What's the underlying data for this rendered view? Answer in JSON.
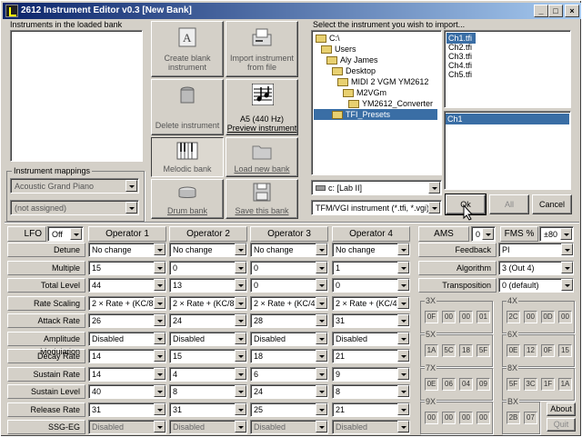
{
  "window": {
    "title": "2612 Instrument Editor v0.3 [New Bank]"
  },
  "bank": {
    "list_label": "Instruments in the loaded bank",
    "mappings_label": "Instrument mappings",
    "mapping_value": "Acoustic Grand Piano",
    "assign_value": "(not assigned)"
  },
  "buttons": {
    "create": "Create blank instrument",
    "import": "Import instrument from file",
    "delete": "Delete instrument",
    "preview_note": "A5 (440 Hz)",
    "preview": "Preview instrument",
    "melodic": "Melodic bank",
    "load": "Load new bank",
    "drum": "Drum bank",
    "save": "Save this bank",
    "ok": "Ok",
    "all": "All",
    "cancel": "Cancel",
    "about": "About",
    "quit": "Quit"
  },
  "import": {
    "label": "Select the instrument you wish to import...",
    "tree": [
      "C:\\",
      "Users",
      "Aly James",
      "Desktop",
      "MIDI 2 VGM YM2612",
      "M2VGm",
      "YM2612_Converter",
      "TFI_Presets"
    ],
    "files": [
      "Ch1.tfi",
      "Ch2.tfi",
      "Ch3.tfi",
      "Ch4.tfi",
      "Ch5.tfi"
    ],
    "channels": [
      "Ch1"
    ],
    "drive": "c: [Lab II]",
    "filter": "TFM/VGI instrument (*.tfi, *.vgi)"
  },
  "lfo": {
    "label": "LFO",
    "value": "Off"
  },
  "operators": [
    "Operator 1",
    "Operator 2",
    "Operator 3",
    "Operator 4"
  ],
  "params": [
    {
      "label": "Detune",
      "values": [
        "No change",
        "No change",
        "No change",
        "No change"
      ],
      "disabled": false
    },
    {
      "label": "Multiple",
      "values": [
        "15",
        "0",
        "0",
        "1"
      ],
      "disabled": false
    },
    {
      "label": "Total Level",
      "values": [
        "44",
        "13",
        "0",
        "0"
      ],
      "disabled": false
    },
    {
      "label": "Rate Scaling",
      "values": [
        "2 × Rate + (KC/8)",
        "2 × Rate + (KC/8)",
        "2 × Rate + (KC/4)",
        "2 × Rate + (KC/4)"
      ],
      "disabled": false
    },
    {
      "label": "Attack Rate",
      "values": [
        "26",
        "24",
        "28",
        "31"
      ],
      "disabled": false
    },
    {
      "label": "Amplitude Modulation",
      "values": [
        "Disabled",
        "Disabled",
        "Disabled",
        "Disabled"
      ],
      "disabled": false
    },
    {
      "label": "Decay Rate",
      "values": [
        "14",
        "15",
        "18",
        "21"
      ],
      "disabled": false
    },
    {
      "label": "Sustain Rate",
      "values": [
        "14",
        "4",
        "6",
        "9"
      ],
      "disabled": false
    },
    {
      "label": "Sustain Level",
      "values": [
        "40",
        "8",
        "24",
        "8"
      ],
      "disabled": false
    },
    {
      "label": "Release Rate",
      "values": [
        "31",
        "31",
        "25",
        "21"
      ],
      "disabled": false
    },
    {
      "label": "SSG-EG",
      "values": [
        "Disabled",
        "Disabled",
        "Disabled",
        "Disabled"
      ],
      "disabled": true
    }
  ],
  "ams": {
    "label": "AMS",
    "value": "0"
  },
  "fms": {
    "label": "FMS %",
    "value": "±80"
  },
  "feedback": {
    "label": "Feedback",
    "value": "PI"
  },
  "algorithm": {
    "label": "Algorithm",
    "value": "3 (Out 4)"
  },
  "transposition": {
    "label": "Transposition",
    "value": "0 (default)"
  },
  "hex": [
    {
      "label": "3X",
      "cells": [
        "0F",
        "00",
        "00",
        "01"
      ]
    },
    {
      "label": "4X",
      "cells": [
        "2C",
        "00",
        "0D",
        "00"
      ]
    },
    {
      "label": "5X",
      "cells": [
        "1A",
        "5C",
        "18",
        "5F"
      ]
    },
    {
      "label": "6X",
      "cells": [
        "0E",
        "12",
        "0F",
        "15"
      ]
    },
    {
      "label": "7X",
      "cells": [
        "0E",
        "06",
        "04",
        "09"
      ]
    },
    {
      "label": "8X",
      "cells": [
        "5F",
        "3C",
        "1F",
        "1A"
      ]
    },
    {
      "label": "9X",
      "cells": [
        "00",
        "00",
        "00",
        "00"
      ]
    },
    {
      "label": "BX",
      "cells": [
        "2B",
        "07"
      ]
    }
  ]
}
